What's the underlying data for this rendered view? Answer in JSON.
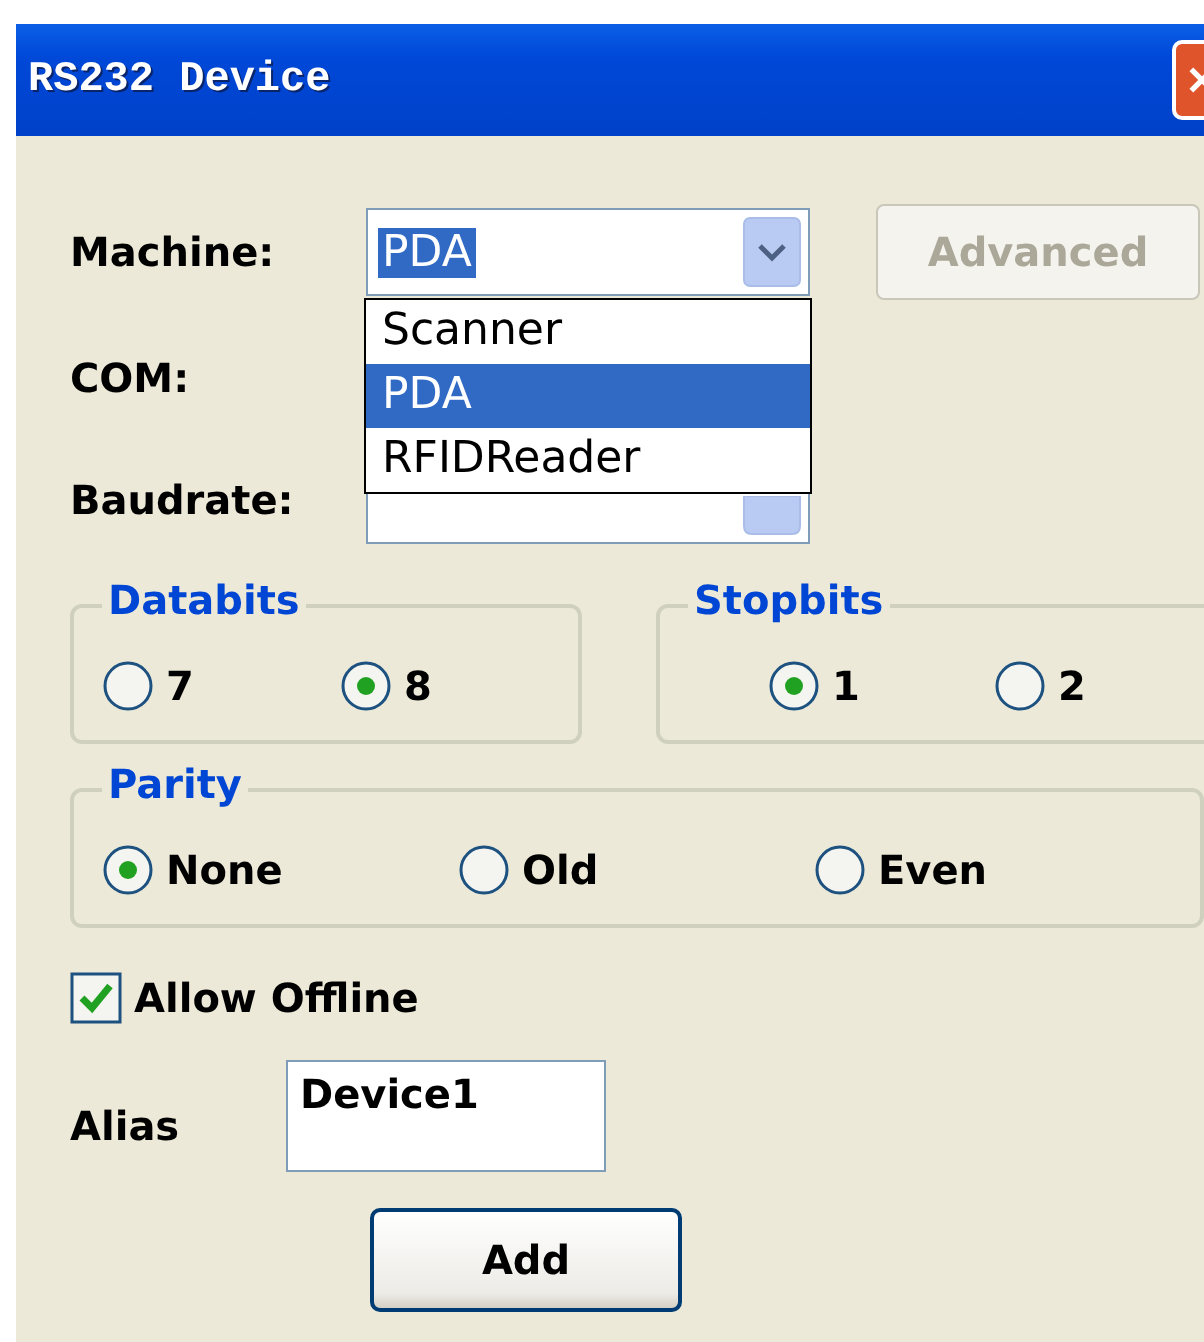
{
  "window": {
    "title": "RS232 Device"
  },
  "fields": [
    {
      "label": "Machine:",
      "kind": "combo",
      "value": "PDA",
      "highlighted": true
    },
    {
      "label": "COM:",
      "kind": "covered"
    },
    {
      "label": "Baudrate:",
      "kind": "combo"
    }
  ],
  "advanced_button": {
    "label": "Advanced",
    "disabled": true
  },
  "dropdown": {
    "items": [
      {
        "label": "Scanner",
        "selected": false
      },
      {
        "label": "PDA",
        "selected": true
      },
      {
        "label": "RFIDReader",
        "selected": false
      }
    ]
  },
  "groups": [
    {
      "title": "Databits",
      "options": [
        {
          "label": "7",
          "selected": false
        },
        {
          "label": "8",
          "selected": true
        }
      ]
    },
    {
      "title": "Stopbits",
      "options": [
        {
          "label": "1",
          "selected": true
        },
        {
          "label": "2",
          "selected": false
        }
      ]
    },
    {
      "title": "Parity",
      "options": [
        {
          "label": "None",
          "selected": true
        },
        {
          "label": "Old",
          "selected": false
        },
        {
          "label": "Even",
          "selected": false
        }
      ]
    }
  ],
  "allow_offline": {
    "label": "Allow Offline",
    "checked": true
  },
  "alias": {
    "label": "Alias",
    "value": "Device1"
  },
  "add_button": {
    "label": "Add"
  }
}
